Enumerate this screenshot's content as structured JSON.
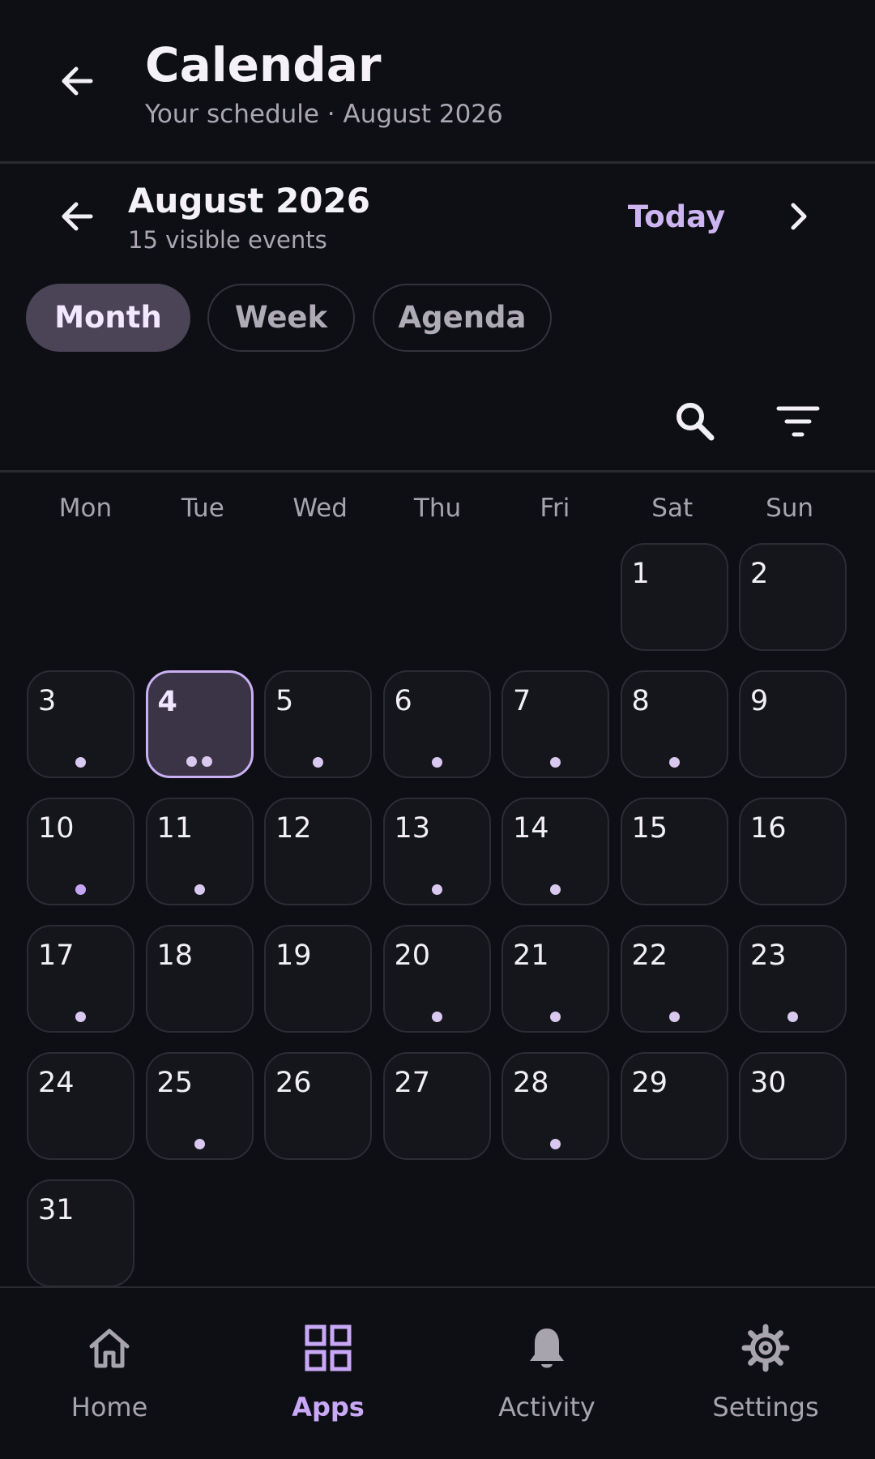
{
  "appbar": {
    "title": "Calendar",
    "subtitle": "Your schedule · August 2026"
  },
  "monthnav": {
    "month_title": "August 2026",
    "event_count": "15 visible events",
    "today_label": "Today"
  },
  "views": [
    {
      "label": "Month",
      "active": true
    },
    {
      "label": "Week",
      "active": false
    },
    {
      "label": "Agenda",
      "active": false
    }
  ],
  "tools": [
    "search-icon",
    "filter-icon"
  ],
  "weekdays": [
    "Mon",
    "Tue",
    "Wed",
    "Thu",
    "Fri",
    "Sat",
    "Sun"
  ],
  "calendar": {
    "first_weekday_index": 5,
    "today": 4,
    "days": [
      {
        "day": "1",
        "events": 0
      },
      {
        "day": "2",
        "events": 0
      },
      {
        "day": "3",
        "events": 1
      },
      {
        "day": "4",
        "events": 2
      },
      {
        "day": "5",
        "events": 1
      },
      {
        "day": "6",
        "events": 1
      },
      {
        "day": "7",
        "events": 1
      },
      {
        "day": "8",
        "events": 1
      },
      {
        "day": "9",
        "events": 0
      },
      {
        "day": "10",
        "events": 1,
        "accent": true
      },
      {
        "day": "11",
        "events": 1
      },
      {
        "day": "12",
        "events": 0
      },
      {
        "day": "13",
        "events": 1
      },
      {
        "day": "14",
        "events": 1
      },
      {
        "day": "15",
        "events": 0
      },
      {
        "day": "16",
        "events": 0
      },
      {
        "day": "17",
        "events": 1
      },
      {
        "day": "18",
        "events": 0
      },
      {
        "day": "19",
        "events": 0
      },
      {
        "day": "20",
        "events": 1
      },
      {
        "day": "21",
        "events": 1
      },
      {
        "day": "22",
        "events": 1
      },
      {
        "day": "23",
        "events": 1
      },
      {
        "day": "24",
        "events": 0
      },
      {
        "day": "25",
        "events": 1
      },
      {
        "day": "26",
        "events": 0
      },
      {
        "day": "27",
        "events": 0
      },
      {
        "day": "28",
        "events": 1
      },
      {
        "day": "29",
        "events": 0
      },
      {
        "day": "30",
        "events": 0
      },
      {
        "day": "31",
        "events": 0
      }
    ]
  },
  "bottomnav": [
    {
      "label": "Home",
      "icon": "home-icon",
      "active": false
    },
    {
      "label": "Apps",
      "icon": "apps-icon",
      "active": true
    },
    {
      "label": "Activity",
      "icon": "bell-icon",
      "active": false
    },
    {
      "label": "Settings",
      "icon": "gear-icon",
      "active": false
    }
  ],
  "colors": {
    "background": "#0e0f14",
    "accent": "#c9a9f7",
    "today_fill": "#3b3346",
    "chip_active": "#4b4456",
    "muted_text": "#a7a4ae"
  }
}
